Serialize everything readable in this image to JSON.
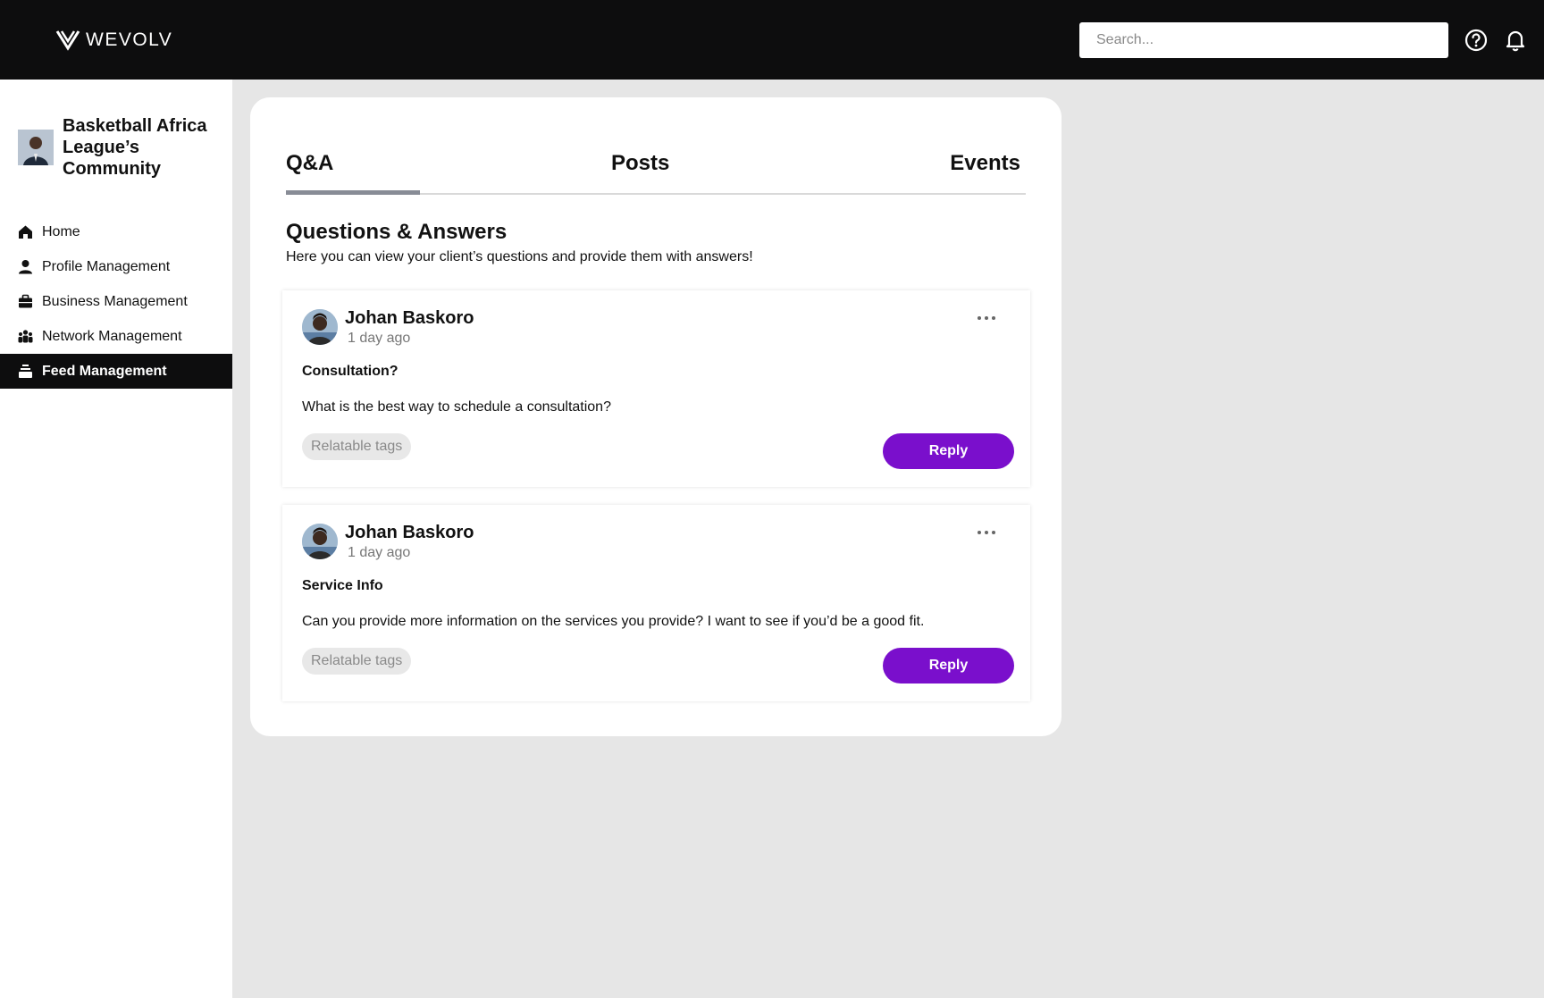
{
  "app": {
    "logo_text": "WEVOLV",
    "search": {
      "placeholder": "Search..."
    }
  },
  "sidebar": {
    "community_name": "Basketball Africa League’s Community",
    "items": [
      {
        "label": "Home",
        "icon": "home-icon"
      },
      {
        "label": "Profile Management",
        "icon": "user-icon"
      },
      {
        "label": "Business Management",
        "icon": "briefcase-icon"
      },
      {
        "label": "Network Management",
        "icon": "people-icon"
      },
      {
        "label": "Feed Management",
        "icon": "feed-icon",
        "active": true
      }
    ]
  },
  "tabs": [
    {
      "label": "Q&A",
      "active": true
    },
    {
      "label": "Posts"
    },
    {
      "label": "Events"
    }
  ],
  "section": {
    "title": "Questions & Answers",
    "subtitle": "Here you can view your client’s questions and provide them with answers!"
  },
  "questions": [
    {
      "author": "Johan Baskoro",
      "time": "1 day ago",
      "subject": "Consultation?",
      "body": "What is the best way to schedule a consultation?",
      "tag": "Relatable tags",
      "reply_label": "Reply"
    },
    {
      "author": "Johan Baskoro",
      "time": "1 day ago",
      "subject": "Service Info",
      "body": "Can you provide more information on the services you provide? I want to see if you’d be a good fit.",
      "tag": "Relatable tags",
      "reply_label": "Reply"
    }
  ],
  "colors": {
    "topbar": "#0d0d0e",
    "accent": "#7a0fcc",
    "background": "#e6e6e6"
  }
}
